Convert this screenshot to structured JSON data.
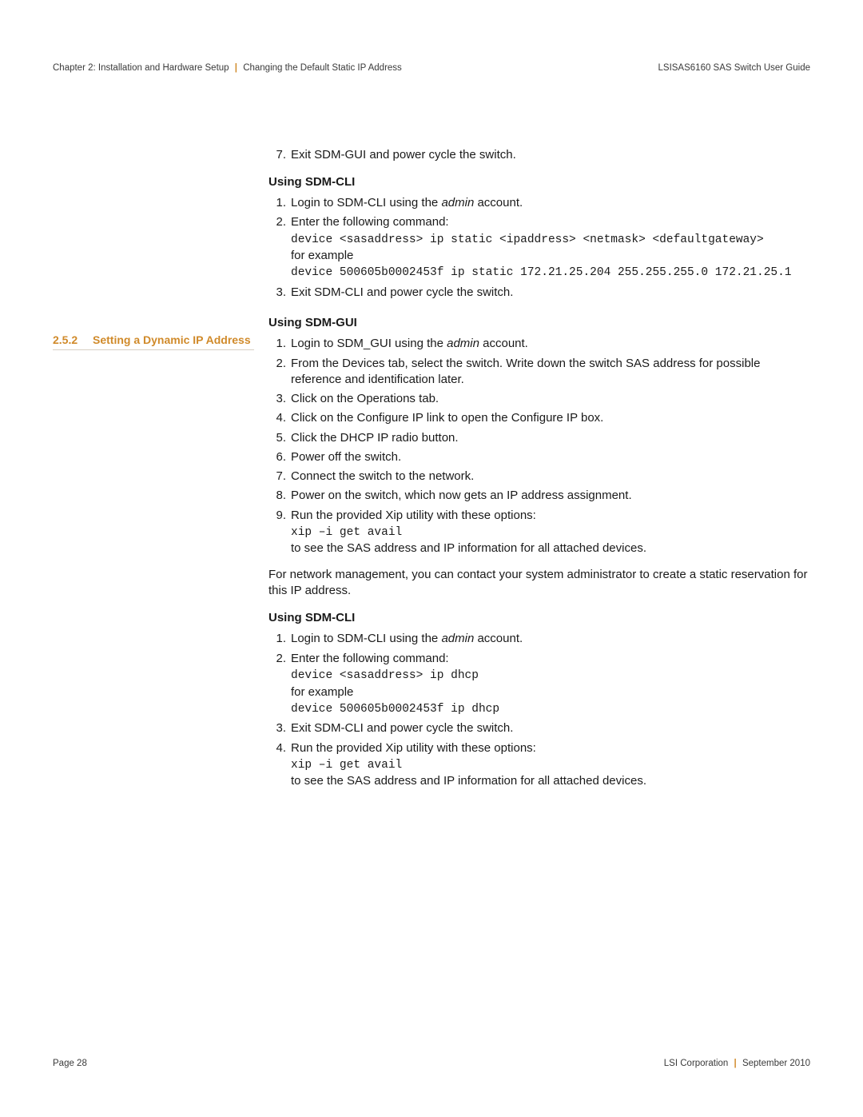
{
  "header": {
    "chapter": "Chapter 2: Installation and Hardware Setup",
    "section": "Changing the Default Static IP Address",
    "doc_title": "LSISAS6160 SAS Switch User Guide"
  },
  "footer": {
    "page": "Page 28",
    "company": "LSI Corporation",
    "date": "September 2010"
  },
  "top": {
    "step7": "Exit SDM-GUI and power cycle the switch.",
    "cli_head": "Using SDM-CLI",
    "cli1_a": "Login to SDM-CLI using the ",
    "cli1_b": "admin",
    "cli1_c": " account.",
    "cli2_intro": "Enter the following command:",
    "cli2_cmd1": "device <sasaddress> ip static <ipaddress> <netmask> <defaultgateway>",
    "cli2_for": "for example",
    "cli2_cmd2": "device 500605b0002453f ip static 172.21.25.204 255.255.255.0 172.21.25.1",
    "cli3": "Exit SDM-CLI and power cycle the switch."
  },
  "sec": {
    "num": "2.5.2",
    "title": "Setting a Dynamic IP Address"
  },
  "gui": {
    "head": "Using SDM-GUI",
    "s1_a": "Login to SDM_GUI using the ",
    "s1_b": "admin",
    "s1_c": " account.",
    "s2": "From the Devices tab, select the switch. Write down the switch SAS address for possible reference and identification later.",
    "s3": "Click on the Operations tab.",
    "s4": "Click on the Configure IP link to open the Configure IP box.",
    "s5": "Click the DHCP IP radio button.",
    "s6": "Power off the switch.",
    "s7": "Connect the switch to the network.",
    "s8": "Power on the switch, which now gets an IP address assignment.",
    "s9_intro": "Run the provided Xip utility with these options:",
    "s9_cmd": "xip –i get avail",
    "s9_tail": "to see the SAS address and IP information for all attached devices.",
    "note": "For network management, you can contact your system administrator to create a static reservation for this IP address."
  },
  "cli2": {
    "head": "Using SDM-CLI",
    "s1_a": "Login to SDM-CLI using the ",
    "s1_b": "admin",
    "s1_c": " account.",
    "s2_intro": "Enter the following command:",
    "s2_cmd1": "device <sasaddress> ip dhcp",
    "s2_for": "for example",
    "s2_cmd2": "device 500605b0002453f ip dhcp",
    "s3": "Exit SDM-CLI and power cycle the switch.",
    "s4_intro": "Run the provided Xip utility with these options:",
    "s4_cmd": "xip –i get avail",
    "s4_tail": "to see the SAS address and IP information for all attached devices."
  }
}
